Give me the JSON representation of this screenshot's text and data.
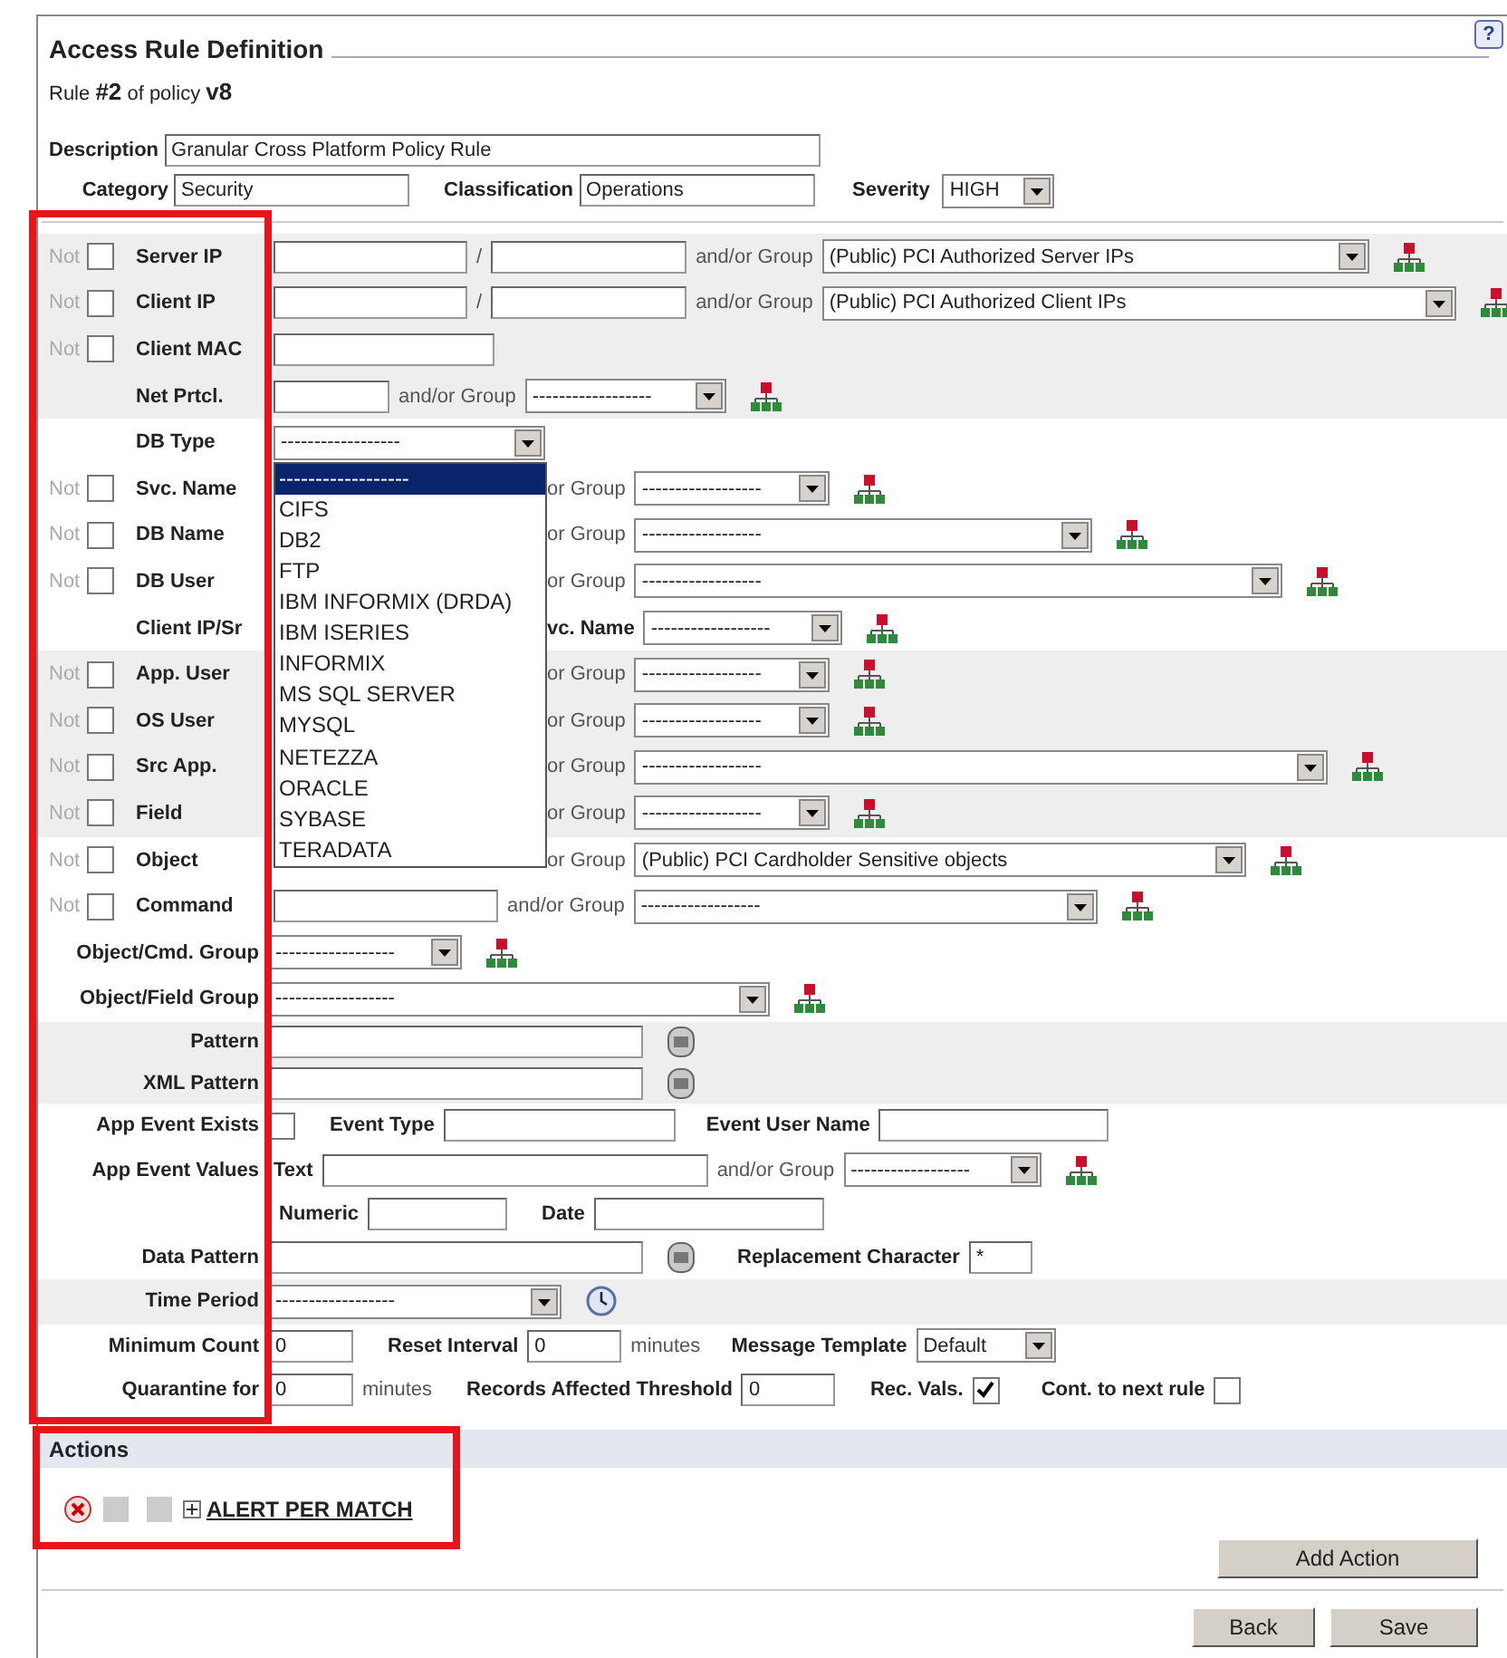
{
  "title": "Access Rule Definition",
  "help_button": "?",
  "rule_line": "Rule **#2** of policy **v8**",
  "description": {
    "label": "Description",
    "value": "Granular Cross Platform Policy Rule"
  },
  "category": {
    "label": "Category",
    "value": "Security"
  },
  "classification": {
    "label": "Classification",
    "value": "Operations"
  },
  "severity": {
    "label": "Severity",
    "value": "HIGH"
  },
  "rows": [
    {
      "kind": "filter",
      "label": "Server IP",
      "shaded": true,
      "not": {
        "label": "Not",
        "checked": false
      },
      "controls": [
        {
          "kind": "field"
        },
        {
          "kind": "caption",
          "text": "/"
        },
        {
          "kind": "field"
        },
        {
          "kind": "caption",
          "text": "and/or Group"
        },
        {
          "kind": "select",
          "value": "(Public) PCI Authorized Server IPs"
        },
        {
          "kind": "group-icon"
        }
      ]
    },
    {
      "kind": "filter",
      "label": "Client IP",
      "shaded": true,
      "not": {
        "label": "Not",
        "checked": false
      },
      "controls": [
        {
          "kind": "field"
        },
        {
          "kind": "caption",
          "text": "/"
        },
        {
          "kind": "field"
        },
        {
          "kind": "caption",
          "text": "and/or Group"
        },
        {
          "kind": "select",
          "value": "(Public) PCI Authorized Client IPs"
        },
        {
          "kind": "group-icon"
        }
      ]
    },
    {
      "kind": "filter",
      "label": "Client MAC",
      "shaded": true,
      "not": {
        "label": "Not",
        "checked": false
      },
      "controls": [
        {
          "kind": "field"
        }
      ]
    },
    {
      "kind": "filter",
      "label": "Net Prtcl.",
      "shaded": true,
      "controls": [
        {
          "kind": "field"
        },
        {
          "kind": "caption",
          "text": "and/or Group"
        },
        {
          "kind": "select",
          "value": "------------------"
        },
        {
          "kind": "group-icon"
        }
      ]
    },
    {
      "kind": "filter",
      "label": "DB Type",
      "shaded": false,
      "controls": [
        {
          "kind": "select",
          "value": "------------------",
          "expanded": true,
          "options": [
            {
              "label": "------------------",
              "selected": true
            },
            {
              "label": "CIFS",
              "selected": false
            },
            {
              "label": "DB2",
              "selected": false
            },
            {
              "label": "FTP",
              "selected": false
            },
            {
              "label": "IBM INFORMIX (DRDA)",
              "selected": false
            },
            {
              "label": "IBM ISERIES",
              "selected": false
            },
            {
              "label": "INFORMIX",
              "selected": false
            },
            {
              "label": "MS SQL SERVER",
              "selected": false
            },
            {
              "label": "MYSQL",
              "selected": false
            },
            {
              "label": "NETEZZA",
              "selected": false
            },
            {
              "label": "ORACLE",
              "selected": false
            },
            {
              "label": "SYBASE",
              "selected": false
            },
            {
              "label": "TERADATA",
              "selected": false
            }
          ]
        }
      ]
    },
    {
      "kind": "filter",
      "label": "Svc. Name",
      "shaded": false,
      "covered": true,
      "not": {
        "label": "Not",
        "checked": false
      },
      "controls": [
        {
          "kind": "caption",
          "text": "or Group"
        },
        {
          "kind": "select",
          "value": "------------------"
        },
        {
          "kind": "group-icon"
        }
      ]
    },
    {
      "kind": "filter",
      "label": "DB Name",
      "shaded": false,
      "covered": true,
      "not": {
        "label": "Not",
        "checked": false
      },
      "controls": [
        {
          "kind": "caption",
          "text": "or Group"
        },
        {
          "kind": "select",
          "value": "------------------"
        },
        {
          "kind": "group-icon"
        }
      ]
    },
    {
      "kind": "filter",
      "label": "DB User",
      "shaded": false,
      "covered": true,
      "not": {
        "label": "Not",
        "checked": false
      },
      "controls": [
        {
          "kind": "caption",
          "text": "or Group"
        },
        {
          "kind": "select",
          "value": "------------------"
        },
        {
          "kind": "group-icon"
        }
      ]
    },
    {
      "kind": "filter",
      "label": "Client IP/Sr",
      "shaded": false,
      "covered": true,
      "controls": [
        {
          "kind": "label",
          "text": "vc. Name"
        },
        {
          "kind": "select",
          "value": "------------------"
        },
        {
          "kind": "group-icon"
        }
      ]
    },
    {
      "kind": "filter",
      "label": "App. User",
      "shaded": true,
      "covered": true,
      "not": {
        "label": "Not",
        "checked": false
      },
      "controls": [
        {
          "kind": "caption",
          "text": "or Group"
        },
        {
          "kind": "select",
          "value": "------------------"
        },
        {
          "kind": "group-icon"
        }
      ]
    },
    {
      "kind": "filter",
      "label": "OS User",
      "shaded": true,
      "covered": true,
      "not": {
        "label": "Not",
        "checked": false
      },
      "controls": [
        {
          "kind": "caption",
          "text": "or Group"
        },
        {
          "kind": "select",
          "value": "------------------"
        },
        {
          "kind": "group-icon"
        }
      ]
    },
    {
      "kind": "filter",
      "label": "Src App.",
      "shaded": true,
      "covered": true,
      "not": {
        "label": "Not",
        "checked": false
      },
      "controls": [
        {
          "kind": "caption",
          "text": "or Group"
        },
        {
          "kind": "select",
          "value": "------------------"
        },
        {
          "kind": "group-icon"
        }
      ]
    },
    {
      "kind": "filter",
      "label": "Field",
      "shaded": true,
      "covered": true,
      "not": {
        "label": "Not",
        "checked": false
      },
      "controls": [
        {
          "kind": "caption",
          "text": "or Group"
        },
        {
          "kind": "select",
          "value": "------------------"
        },
        {
          "kind": "group-icon"
        }
      ]
    },
    {
      "kind": "filter",
      "label": "Object",
      "shaded": false,
      "covered": true,
      "not": {
        "label": "Not",
        "checked": false
      },
      "controls": [
        {
          "kind": "caption",
          "text": "or Group"
        },
        {
          "kind": "select",
          "value": "(Public) PCI Cardholder Sensitive objects"
        },
        {
          "kind": "group-icon"
        }
      ]
    },
    {
      "kind": "filter",
      "label": "Command",
      "shaded": false,
      "not": {
        "label": "Not",
        "checked": false
      },
      "controls": [
        {
          "kind": "field"
        },
        {
          "kind": "caption",
          "text": "and/or Group"
        },
        {
          "kind": "select",
          "value": "------------------"
        },
        {
          "kind": "group-icon"
        }
      ]
    },
    {
      "kind": "setting",
      "label": "Object/Cmd. Group",
      "shaded": false,
      "controls": [
        {
          "kind": "select",
          "value": "------------------"
        },
        {
          "kind": "group-icon"
        }
      ]
    },
    {
      "kind": "setting",
      "label": "Object/Field Group",
      "shaded": false,
      "controls": [
        {
          "kind": "select",
          "value": "------------------"
        },
        {
          "kind": "group-icon"
        }
      ]
    },
    {
      "kind": "setting",
      "label": "Pattern",
      "shaded": true,
      "controls": [
        {
          "kind": "field"
        },
        {
          "kind": "re-icon"
        }
      ]
    },
    {
      "kind": "setting",
      "label": "XML Pattern",
      "shaded": true,
      "controls": [
        {
          "kind": "field"
        },
        {
          "kind": "re-icon"
        }
      ]
    },
    {
      "kind": "setting",
      "label": "App Event Exists",
      "shaded": false,
      "controls": [
        {
          "kind": "checkbox",
          "checked": false
        },
        {
          "kind": "label",
          "text": "Event Type"
        },
        {
          "kind": "field"
        },
        {
          "kind": "label",
          "text": "Event User Name"
        },
        {
          "kind": "field"
        }
      ]
    },
    {
      "kind": "setting",
      "label": "App Event Values",
      "shaded": false,
      "controls": [
        {
          "kind": "label",
          "text": "Text"
        },
        {
          "kind": "field"
        },
        {
          "kind": "caption",
          "text": "and/or Group"
        },
        {
          "kind": "select",
          "value": "------------------"
        },
        {
          "kind": "group-icon"
        }
      ]
    },
    {
      "kind": "setting",
      "shaded": false,
      "controls": [
        {
          "kind": "label",
          "text": "Numeric"
        },
        {
          "kind": "field"
        },
        {
          "kind": "label",
          "text": "Date"
        },
        {
          "kind": "field"
        }
      ]
    },
    {
      "kind": "setting",
      "label": "Data Pattern",
      "shaded": false,
      "controls": [
        {
          "kind": "field"
        },
        {
          "kind": "re-icon"
        },
        {
          "kind": "label",
          "text": "Replacement Character"
        },
        {
          "kind": "field",
          "value": "*"
        }
      ]
    },
    {
      "kind": "setting",
      "label": "Time Period",
      "shaded": true,
      "controls": [
        {
          "kind": "select",
          "value": "------------------"
        },
        {
          "kind": "clock-icon"
        }
      ]
    },
    {
      "kind": "setting",
      "label": "Minimum Count",
      "shaded": false,
      "controls": [
        {
          "kind": "field",
          "value": "0"
        },
        {
          "kind": "label",
          "text": "Reset Interval"
        },
        {
          "kind": "field",
          "value": "0"
        },
        {
          "kind": "caption",
          "text": "minutes"
        },
        {
          "kind": "label",
          "text": "Message Template"
        },
        {
          "kind": "select",
          "value": "Default"
        }
      ]
    },
    {
      "kind": "setting",
      "label": "Quarantine for",
      "shaded": false,
      "controls": [
        {
          "kind": "field",
          "value": "0"
        },
        {
          "kind": "caption",
          "text": "minutes"
        },
        {
          "kind": "label",
          "text": "Records Affected Threshold"
        },
        {
          "kind": "field",
          "value": "0"
        },
        {
          "kind": "label",
          "text": "Rec. Vals."
        },
        {
          "kind": "checkbox",
          "checked": true
        },
        {
          "kind": "label",
          "text": "Cont. to next rule"
        },
        {
          "kind": "checkbox",
          "checked": false
        }
      ]
    }
  ],
  "actions": {
    "title": "Actions",
    "items": [
      {
        "label": "ALERT PER MATCH"
      }
    ]
  },
  "buttons": [
    {
      "label": "Add Action"
    },
    {
      "label": "Back"
    },
    {
      "label": "Save"
    }
  ]
}
